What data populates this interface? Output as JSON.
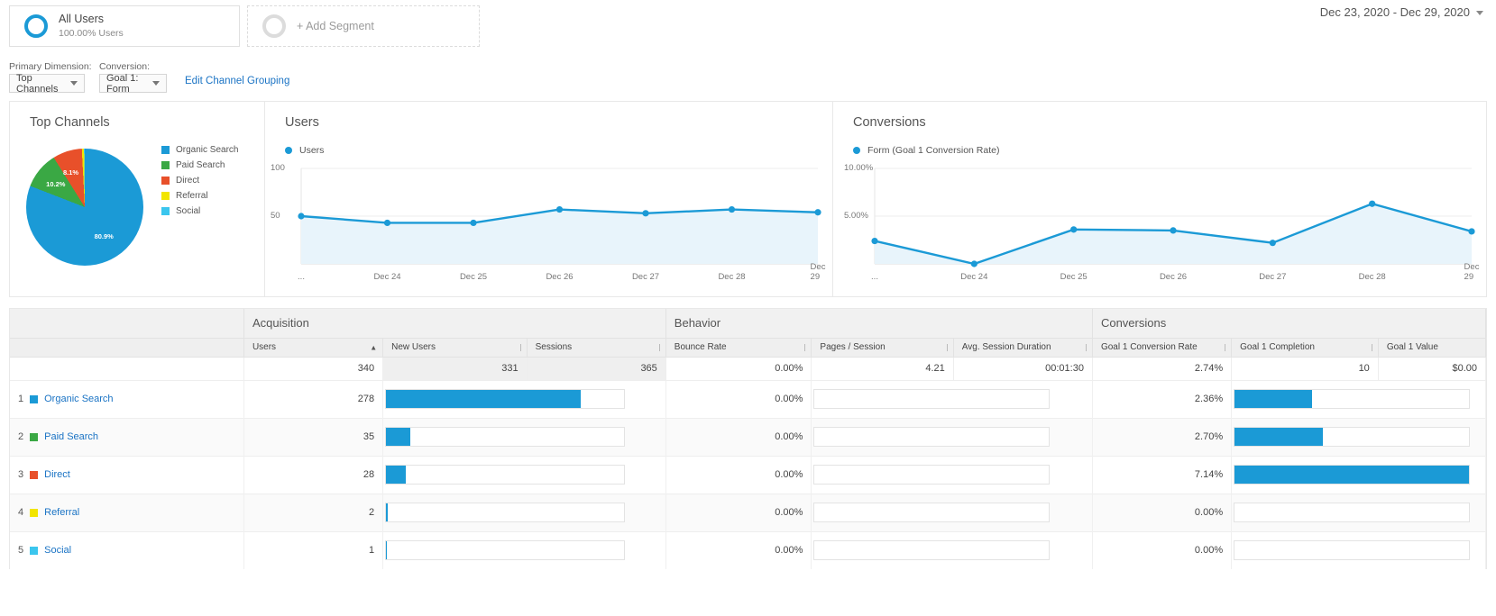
{
  "segments": {
    "all_users": {
      "title": "All Users",
      "subtitle": "100.00% Users"
    },
    "add_segment": {
      "label": "+ Add Segment"
    }
  },
  "date_range": "Dec 23, 2020 - Dec 29, 2020",
  "controls": {
    "primary_dimension_label": "Primary Dimension:",
    "primary_dimension_value": "Top Channels",
    "conversion_label": "Conversion:",
    "conversion_value": "Goal 1: Form",
    "edit_channel_grouping": "Edit Channel Grouping"
  },
  "colors": {
    "organic_search": "#1b9ad6",
    "paid_search": "#3aa844",
    "direct": "#e8502a",
    "referral": "#f2e500",
    "social": "#3bc6ee",
    "accent": "#1b9ad6",
    "link": "#1a73c4"
  },
  "panels": {
    "pie_title": "Top Channels",
    "users_title": "Users",
    "users_legend": "Users",
    "conversions_title": "Conversions",
    "conversions_legend": "Form (Goal 1 Conversion Rate)"
  },
  "chart_data": [
    {
      "type": "pie",
      "title": "Top Channels",
      "legend_position": "right",
      "labels": [
        "Organic Search",
        "Paid Search",
        "Direct",
        "Referral",
        "Social"
      ],
      "values": [
        80.9,
        10.2,
        8.1,
        0.6,
        0.3
      ],
      "slice_labels": [
        "80.9%",
        "10.2%",
        "8.1%",
        "",
        ""
      ],
      "colors": [
        "#1b9ad6",
        "#3aa844",
        "#e8502a",
        "#f2e500",
        "#3bc6ee"
      ]
    },
    {
      "type": "area",
      "title": "Users",
      "series": [
        {
          "name": "Users",
          "values": [
            50,
            43,
            43,
            57,
            53,
            57,
            54
          ]
        }
      ],
      "categories": [
        "Dec 23",
        "Dec 24",
        "Dec 25",
        "Dec 26",
        "Dec 27",
        "Dec 28",
        "Dec 29"
      ],
      "tick_labels": [
        "...",
        "Dec 24",
        "Dec 25",
        "Dec 26",
        "Dec 27",
        "Dec 28",
        "Dec 29"
      ],
      "ylabel": "",
      "xlabel": "",
      "ytick_labels": [
        "100",
        "50"
      ],
      "ylim": [
        0,
        100
      ],
      "grid": true
    },
    {
      "type": "area",
      "title": "Conversions",
      "series": [
        {
          "name": "Form (Goal 1 Conversion Rate)",
          "values": [
            2.4,
            0.0,
            3.6,
            3.5,
            2.2,
            6.3,
            3.4
          ]
        }
      ],
      "categories": [
        "Dec 23",
        "Dec 24",
        "Dec 25",
        "Dec 26",
        "Dec 27",
        "Dec 28",
        "Dec 29"
      ],
      "tick_labels": [
        "...",
        "Dec 24",
        "Dec 25",
        "Dec 26",
        "Dec 27",
        "Dec 28",
        "Dec 29"
      ],
      "ylabel": "",
      "xlabel": "",
      "ytick_labels": [
        "10.00%",
        "5.00%"
      ],
      "ylim": [
        0,
        10
      ],
      "grid": true
    }
  ],
  "table": {
    "groups": [
      {
        "label": "",
        "span": 1
      },
      {
        "label": "Acquisition",
        "span": 3
      },
      {
        "label": "Behavior",
        "span": 3
      },
      {
        "label": "Conversions",
        "span": 3
      }
    ],
    "columns": [
      {
        "label": "",
        "sort": "none"
      },
      {
        "label": "Users",
        "sort": "desc"
      },
      {
        "label": "New Users",
        "sort": "none"
      },
      {
        "label": "Sessions",
        "sort": "none"
      },
      {
        "label": "Bounce Rate",
        "sort": "none"
      },
      {
        "label": "Pages / Session",
        "sort": "none"
      },
      {
        "label": "Avg. Session Duration",
        "sort": "none"
      },
      {
        "label": "Goal 1 Conversion Rate",
        "sort": "none"
      },
      {
        "label": "Goal 1 Completion",
        "sort": "none"
      },
      {
        "label": "Goal 1 Value",
        "sort": "none"
      }
    ],
    "totals": {
      "users": "340",
      "new_users": "331",
      "sessions": "365",
      "bounce_rate": "0.00%",
      "pages_session": "4.21",
      "avg_duration": "00:01:30",
      "goal_conv_rate": "2.74%",
      "goal_completion": "10",
      "goal_value": "$0.00"
    },
    "rows": [
      {
        "index": "1",
        "channel": "Organic Search",
        "color": "#1b9ad6",
        "users": "278",
        "users_pct": 81.8,
        "new_users": "",
        "sessions": "",
        "bounce_rate": "0.00%",
        "pages_session": "",
        "avg_duration": "",
        "goal_conv_rate": "2.36%",
        "goal_conv_pct": 33.1,
        "goal_completion": "",
        "goal_value": ""
      },
      {
        "index": "2",
        "channel": "Paid Search",
        "color": "#3aa844",
        "users": "35",
        "users_pct": 10.3,
        "new_users": "",
        "sessions": "",
        "bounce_rate": "0.00%",
        "pages_session": "",
        "avg_duration": "",
        "goal_conv_rate": "2.70%",
        "goal_conv_pct": 37.8,
        "goal_completion": "",
        "goal_value": ""
      },
      {
        "index": "3",
        "channel": "Direct",
        "color": "#e8502a",
        "users": "28",
        "users_pct": 8.2,
        "new_users": "",
        "sessions": "",
        "bounce_rate": "0.00%",
        "pages_session": "",
        "avg_duration": "",
        "goal_conv_rate": "7.14%",
        "goal_conv_pct": 100,
        "goal_completion": "",
        "goal_value": ""
      },
      {
        "index": "4",
        "channel": "Referral",
        "color": "#f2e500",
        "users": "2",
        "users_pct": 0.6,
        "new_users": "",
        "sessions": "",
        "bounce_rate": "0.00%",
        "pages_session": "",
        "avg_duration": "",
        "goal_conv_rate": "0.00%",
        "goal_conv_pct": 0,
        "goal_completion": "",
        "goal_value": ""
      },
      {
        "index": "5",
        "channel": "Social",
        "color": "#3bc6ee",
        "users": "1",
        "users_pct": 0.3,
        "new_users": "",
        "sessions": "",
        "bounce_rate": "0.00%",
        "pages_session": "",
        "avg_duration": "",
        "goal_conv_rate": "0.00%",
        "goal_conv_pct": 0,
        "goal_completion": "",
        "goal_value": ""
      }
    ]
  }
}
